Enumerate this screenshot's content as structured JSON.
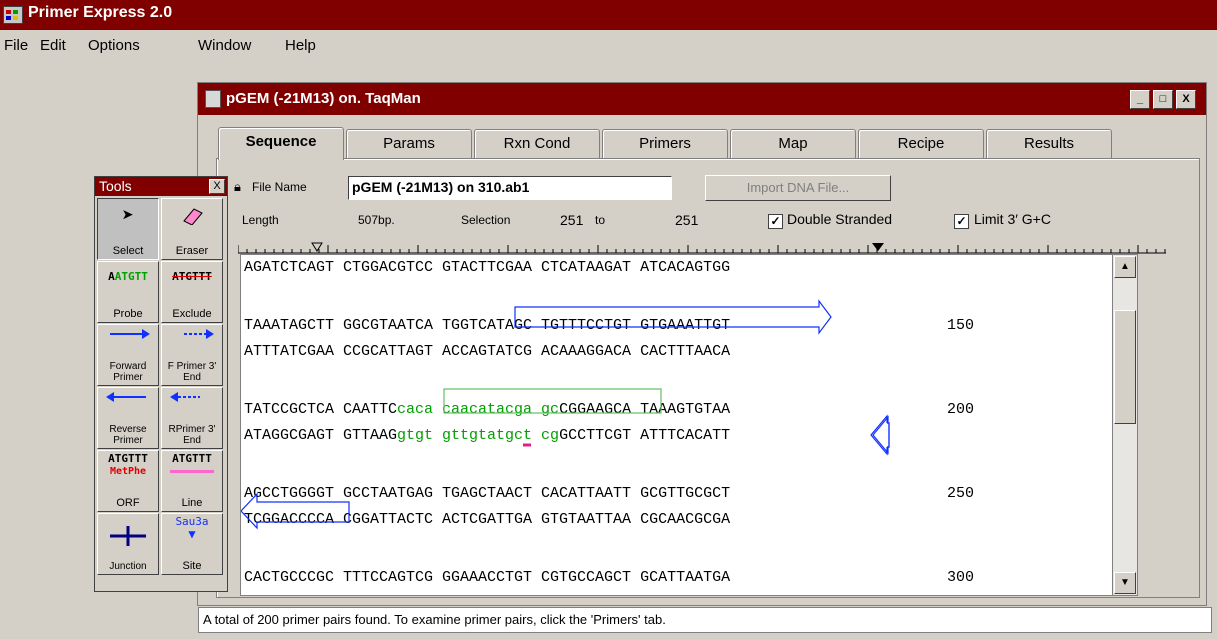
{
  "app": {
    "title": "Primer Express 2.0"
  },
  "menu": [
    {
      "label": "File"
    },
    {
      "label": "Edit"
    },
    {
      "label": "Options"
    },
    {
      "label": "Window"
    },
    {
      "label": "Help"
    }
  ],
  "child": {
    "title": "pGEM (-21M13) on. TaqMan",
    "buttons": {
      "minimize": "_",
      "restore": "□",
      "close": "X"
    }
  },
  "tabs": [
    "Sequence",
    "Params",
    "Rxn Cond",
    "Primers",
    "Map",
    "Recipe",
    "Results"
  ],
  "active_tab": "Sequence",
  "file": {
    "label": "File Name",
    "value": "pGEM (-21M13) on 310.ab1",
    "import_button": "Import DNA File..."
  },
  "info": {
    "length_label": "Length",
    "length_value": "507bp.",
    "selection_label": "Selection",
    "selection_start": "251",
    "selection_to": "to",
    "selection_end": "251",
    "double_stranded": {
      "label": "Double Stranded",
      "checked": true
    },
    "limit_gc": {
      "label": "Limit 3′ G+C",
      "checked": true
    }
  },
  "tools": {
    "title": "Tools",
    "close": "X",
    "items": [
      {
        "label": "Select"
      },
      {
        "label": "Eraser"
      },
      {
        "label": "Probe",
        "glyph": "ATGTT"
      },
      {
        "label": "Exclude",
        "glyph": "ATGTTT"
      },
      {
        "label": "Forward Primer"
      },
      {
        "label": "F Primer 3' End"
      },
      {
        "label": "Reverse Primer"
      },
      {
        "label": "RPrimer 3' End"
      },
      {
        "label": "ORF",
        "glyph": "ATGTTT",
        "glyph2": "MetPhe"
      },
      {
        "label": "Line",
        "glyph": "ATGTTT"
      },
      {
        "label": "Junction"
      },
      {
        "label": "Site",
        "glyph": "Sau3a"
      }
    ]
  },
  "sequence": {
    "lines": [
      {
        "a": "AGATCTCAGT CTGGACGTCC GTACTTCGAA CTCATAAGAT ATCACAGTGG",
        "num": ""
      },
      {
        "a": "TAAATAGCTT GGCGTAATCA TGGTCATAGC TGTTTCCTGT GTGAAATTGT",
        "num": "150"
      },
      {
        "a": "ATTTATCGAA CCGCATTAGT ACCAGTATCG ACAAAGGACA CACTTTAACA",
        "num": ""
      },
      {
        "pre": "TATCCGCTCA CAATTC",
        "green": "caca caacatacga gc",
        "post": "CGGAAGCA TAAAGTGTAA",
        "num": "200"
      },
      {
        "pre": "ATAGGCGAGT GTTAAG",
        "green": "gtgt gttgtatgct cg",
        "post": "GCCTTCGT ATTTCACATT",
        "num": ""
      },
      {
        "a": "AGCCTGGGGT GCCTAATGAG TGAGCTAACT CACATTAATT GCGTTGCGCT",
        "num": "250"
      },
      {
        "a": "TCGGACCCCA CGGATTACTC ACTCGATTGA GTGTAATTAA CGCAACGCGA",
        "num": ""
      },
      {
        "a": "CACTGCCCGC TTTCCAGTCG GGAAACCTGT CGTGCCAGCT GCATTAATGA",
        "num": "300"
      }
    ]
  },
  "status": "A total of 200 primer pairs found.  To examine primer pairs, click the 'Primers' tab."
}
